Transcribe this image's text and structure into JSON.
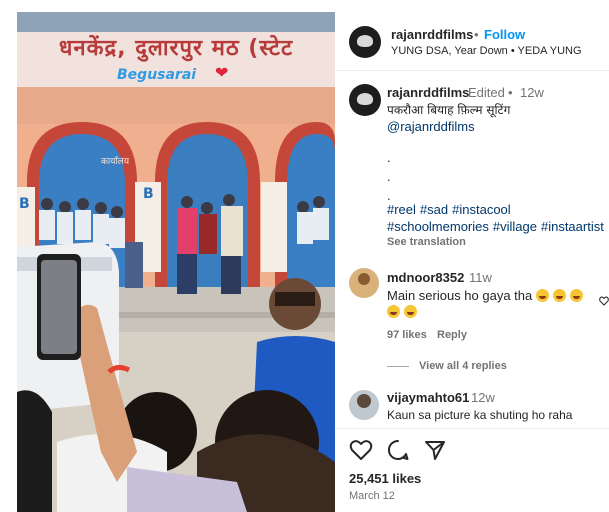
{
  "media": {
    "banner_text": "धनकेंद्र, दुलारपुर मठ (स्टेट",
    "overlay_text": "Begusarai",
    "heart": "❤",
    "wall_label": "कार्यालय",
    "pillar_letter_left": "B",
    "pillar_letter_right": "B"
  },
  "header": {
    "username": "rajanrddfilms",
    "separator": "•",
    "follow_label": "Follow",
    "audio": "YUNG DSA, Year Down • YEDA YUNG"
  },
  "caption": {
    "username": "rajanrddfilms",
    "edited": "Edited",
    "separator": "•",
    "time": "12w",
    "title": "पकरौआ बियाह फ़िल्म सूटिंग",
    "mention": "@rajanrddfilms",
    "dots": [
      ".",
      " .",
      "."
    ],
    "hashtags_line1": [
      "#reel",
      "#sad",
      "#instacool"
    ],
    "hashtags_line2": [
      "#schoolmemories",
      "#village",
      "#instaartist"
    ],
    "see_translation": "See translation"
  },
  "comments": [
    {
      "username": "mdnoor8352",
      "time": "11w",
      "text": "Main serious ho gaya tha",
      "likes": "97 likes",
      "reply_label": "Reply",
      "view_replies": "View all 4 replies"
    },
    {
      "username": "vijaymahto61",
      "time": "12w",
      "text": "Kaun sa picture ka shuting ho raha"
    }
  ],
  "actions": {
    "likes": "25,451 likes",
    "date": "March 12"
  },
  "colors": {
    "link": "#00376b",
    "follow": "#0095f6",
    "muted": "#737373"
  }
}
